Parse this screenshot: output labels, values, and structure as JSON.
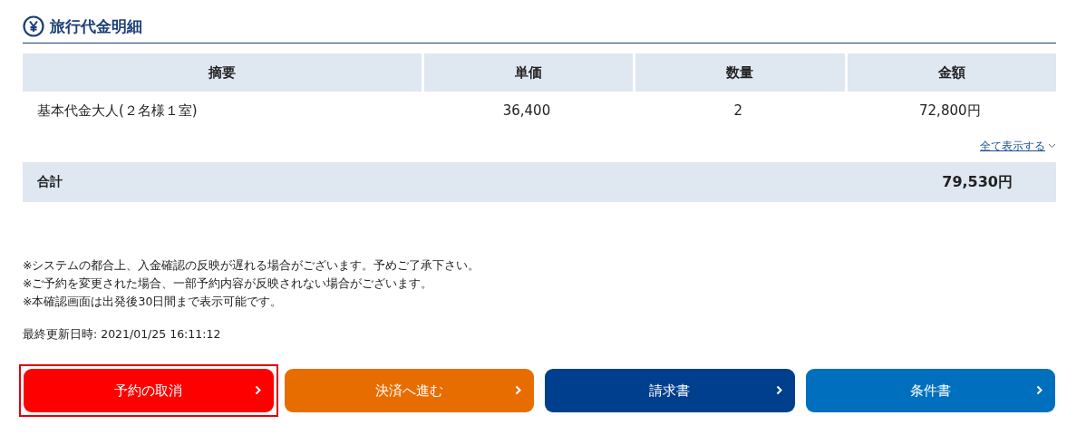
{
  "section": {
    "title": "旅行代金明細"
  },
  "table": {
    "columns": [
      "摘要",
      "単価",
      "数量",
      "金額"
    ],
    "rows": [
      [
        "基本代金大人(２名様１室)",
        "36,400",
        "2",
        "72,800円"
      ]
    ]
  },
  "show_all_link": {
    "label": "全て表示する",
    "expanded": false
  },
  "total": {
    "label": "合計",
    "amount": "79,530円"
  },
  "notes": [
    "※システムの都合上、入金確認の反映が遅れる場合がございます。予めご了承下さい。",
    "※ご予約を変更された場合、一部予約内容が反映されない場合がございます。",
    "※本確認画面は出発後30日間まで表示可能です。"
  ],
  "last_updated": "最終更新日時: 2021/01/25 16:11:12",
  "buttons": [
    {
      "label": "予約の取消",
      "color": "#ff0000",
      "highlighted": true
    },
    {
      "label": "決済へ進む",
      "color": "#e86d00",
      "highlighted": false
    },
    {
      "label": "請求書",
      "color": "#003f8e",
      "highlighted": false
    },
    {
      "label": "条件書",
      "color": "#0070be",
      "highlighted": false
    }
  ]
}
